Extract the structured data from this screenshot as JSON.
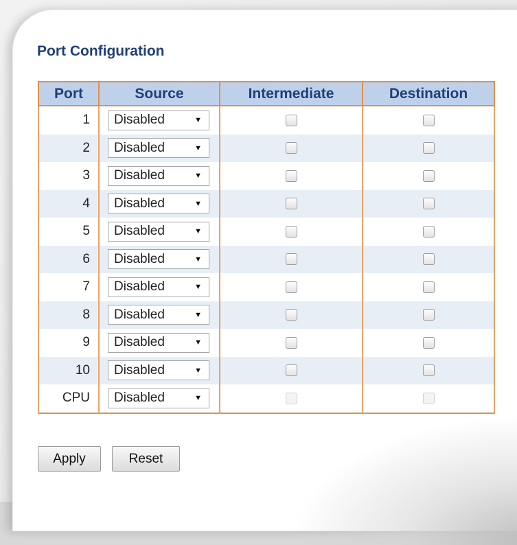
{
  "page": {
    "title": "Port Configuration"
  },
  "table": {
    "headers": {
      "port": "Port",
      "source": "Source",
      "intermediate": "Intermediate",
      "destination": "Destination"
    },
    "rows": [
      {
        "port": "1",
        "source": "Disabled",
        "intermediate": false,
        "destination": false,
        "enabled": true
      },
      {
        "port": "2",
        "source": "Disabled",
        "intermediate": false,
        "destination": false,
        "enabled": true
      },
      {
        "port": "3",
        "source": "Disabled",
        "intermediate": false,
        "destination": false,
        "enabled": true
      },
      {
        "port": "4",
        "source": "Disabled",
        "intermediate": false,
        "destination": false,
        "enabled": true
      },
      {
        "port": "5",
        "source": "Disabled",
        "intermediate": false,
        "destination": false,
        "enabled": true
      },
      {
        "port": "6",
        "source": "Disabled",
        "intermediate": false,
        "destination": false,
        "enabled": true
      },
      {
        "port": "7",
        "source": "Disabled",
        "intermediate": false,
        "destination": false,
        "enabled": true
      },
      {
        "port": "8",
        "source": "Disabled",
        "intermediate": false,
        "destination": false,
        "enabled": true
      },
      {
        "port": "9",
        "source": "Disabled",
        "intermediate": false,
        "destination": false,
        "enabled": true
      },
      {
        "port": "10",
        "source": "Disabled",
        "intermediate": false,
        "destination": false,
        "enabled": true
      },
      {
        "port": "CPU",
        "source": "Disabled",
        "intermediate": false,
        "destination": false,
        "enabled": false
      }
    ]
  },
  "buttons": {
    "apply": "Apply",
    "reset": "Reset"
  },
  "icons": {
    "dropdown": "chevron-down-icon"
  },
  "colors": {
    "title": "#1f3f7a",
    "header_bg": "#bfd1ea",
    "border": "#e0904a",
    "row_alt": "#e8eef6"
  }
}
